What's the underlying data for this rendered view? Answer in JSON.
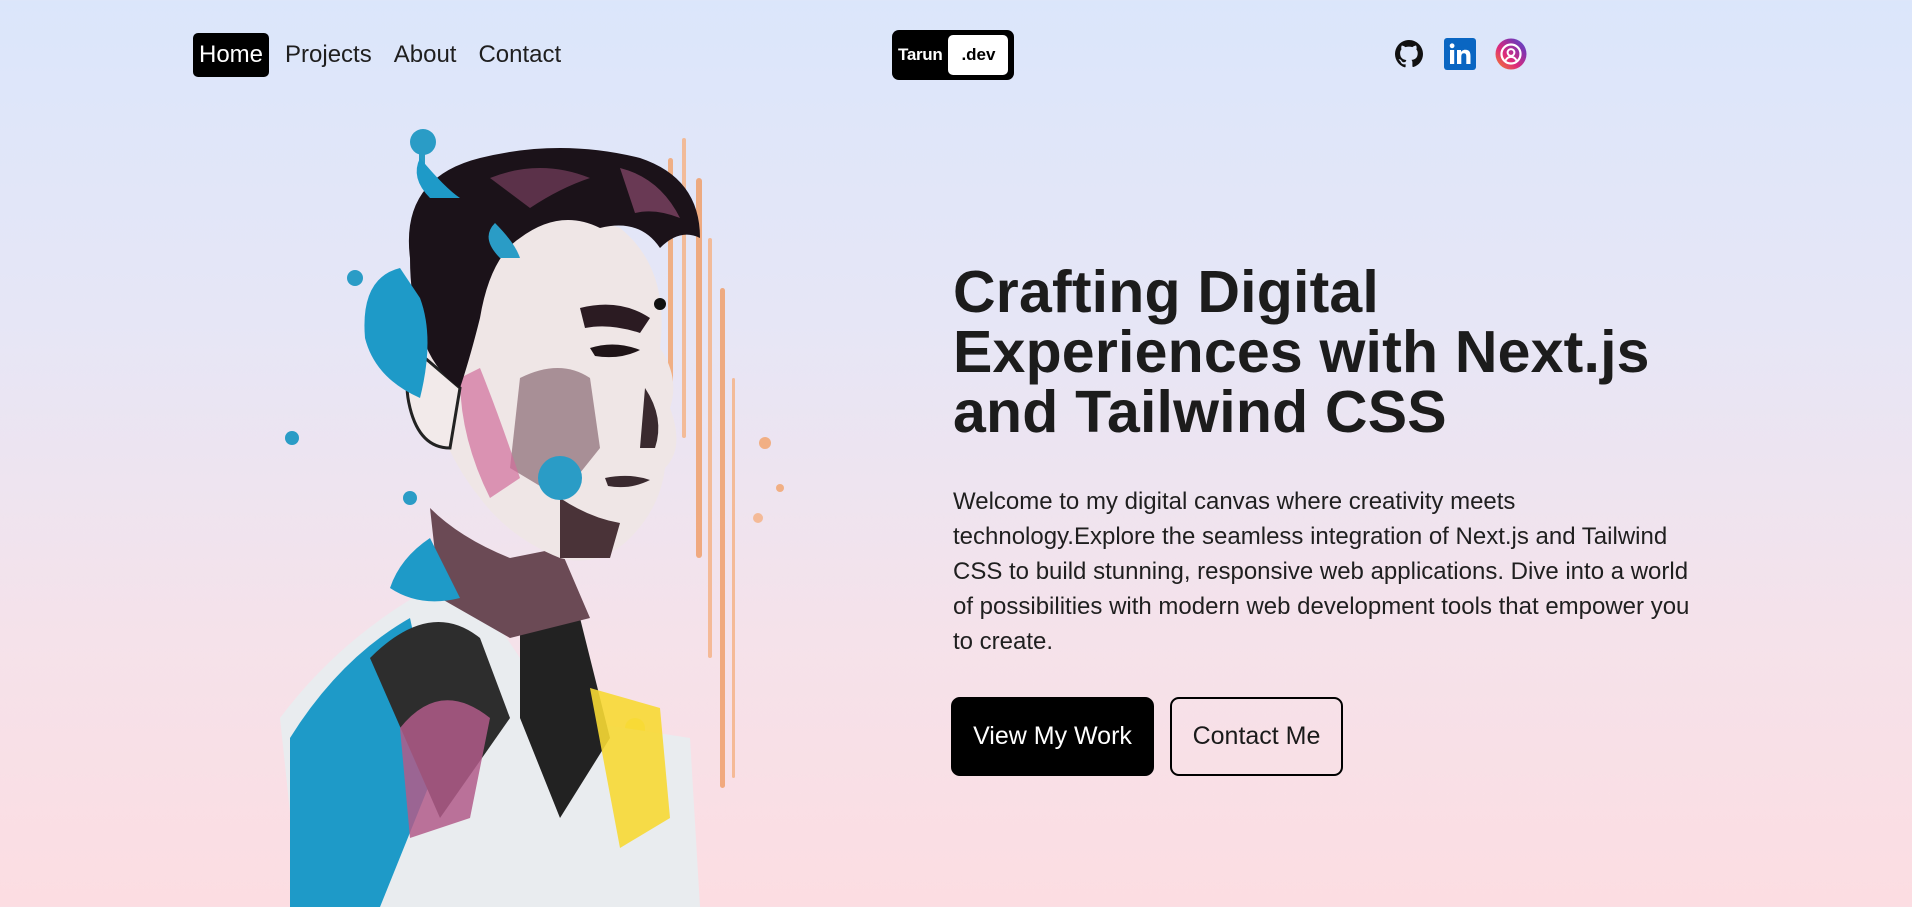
{
  "nav": {
    "items": [
      {
        "label": "Home",
        "active": true
      },
      {
        "label": "Projects",
        "active": false
      },
      {
        "label": "About",
        "active": false
      },
      {
        "label": "Contact",
        "active": false
      }
    ]
  },
  "logo": {
    "left": "Tarun",
    "right": ".dev"
  },
  "socials": [
    {
      "icon": "github-icon",
      "color": "#111111"
    },
    {
      "icon": "linkedin-icon",
      "color": "#0a66c2"
    },
    {
      "icon": "instagram-icon",
      "color": "#c13584"
    }
  ],
  "hero": {
    "title": "Crafting Digital Experiences with Next.js and Tailwind CSS",
    "description": "Welcome to my digital canvas where creativity meets technology.Explore the seamless integration of Next.js and Tailwind CSS to build stunning, responsive web applications. Dive into a world of possibilities with modern web development tools that empower you to create.",
    "primary_button": "View My Work",
    "secondary_button": "Contact Me"
  },
  "colors": {
    "accent": "#000000",
    "background_top": "#dbe6fb",
    "background_bottom": "#fcdde2"
  }
}
